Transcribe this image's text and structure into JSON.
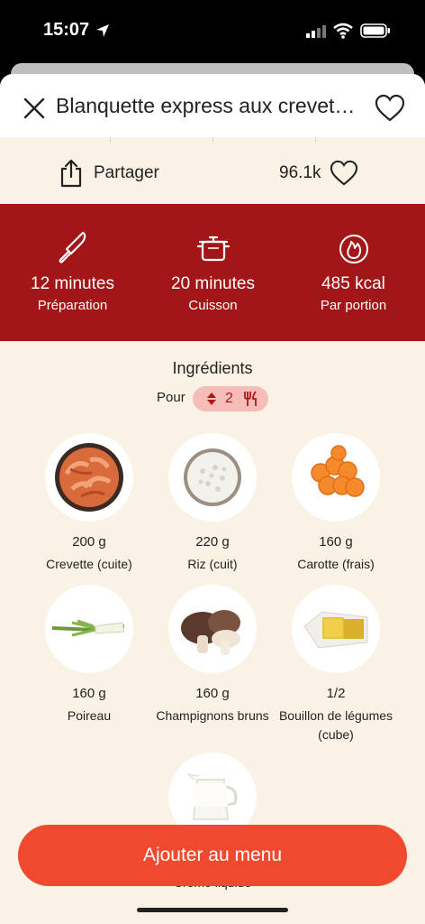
{
  "status": {
    "time": "15:07"
  },
  "header": {
    "title": "Blanquette express aux crevet…"
  },
  "actions": {
    "share_label": "Partager",
    "likes_count": "96.1k"
  },
  "stats": [
    {
      "icon": "knife-icon",
      "value": "12 minutes",
      "label": "Préparation"
    },
    {
      "icon": "pot-icon",
      "value": "20 minutes",
      "label": "Cuisson"
    },
    {
      "icon": "flame-icon",
      "value": "485 kcal",
      "label": "Par portion"
    }
  ],
  "ingredients": {
    "title": "Ingrédients",
    "servings_label": "Pour",
    "servings": "2",
    "items": [
      {
        "qty": "200 g",
        "name": "Crevette (cuite)"
      },
      {
        "qty": "220 g",
        "name": "Riz (cuit)"
      },
      {
        "qty": "160 g",
        "name": "Carotte (frais)"
      },
      {
        "qty": "160 g",
        "name": "Poireau"
      },
      {
        "qty": "160 g",
        "name": "Champignons bruns"
      },
      {
        "qty": "1/2",
        "name": "Bouillon de légumes (cube)"
      },
      {
        "qty": "",
        "name": "Crème liquide"
      }
    ]
  },
  "cta": {
    "label": "Ajouter au menu"
  },
  "colors": {
    "red_band": "#a31617",
    "cta": "#ef4a2f",
    "pill": "#f6bcb8",
    "background": "#fbf2e6"
  }
}
